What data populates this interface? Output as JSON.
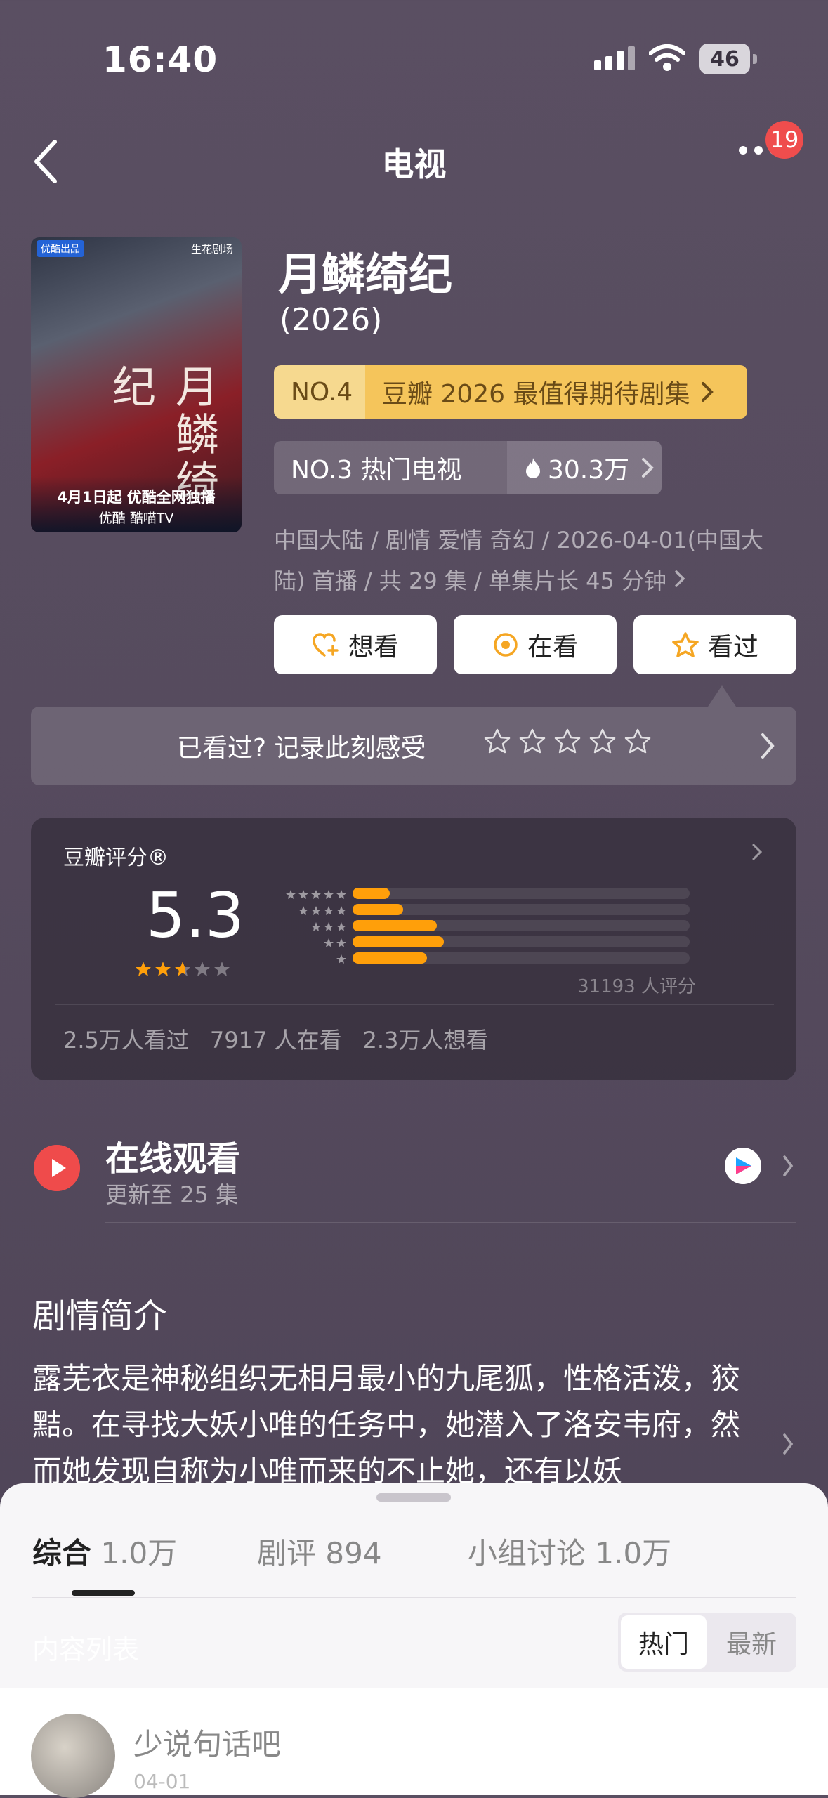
{
  "status": {
    "time": "16:40",
    "battery": "46"
  },
  "nav": {
    "title": "电视",
    "badge": "19"
  },
  "poster": {
    "tag_left": "优酷出品",
    "tag_right": "生花剧场",
    "title": "月鳞绮纪",
    "date": "4月1日起 优酷全网独播",
    "platform": "优酷  酷喵TV"
  },
  "show": {
    "title": "月鳞绮纪",
    "year": "(2026)",
    "rank": {
      "no": "NO.4",
      "text": "豆瓣 2026 最值得期待剧集"
    },
    "hot": {
      "no": "NO.3 热门电视",
      "heat": "30.3万"
    },
    "meta": "中国大陆 / 剧情 爱情 奇幻 / 2026-04-01(中国大陆) 首播 / 共 29 集 / 单集片长 45 分钟",
    "actions": {
      "want": "想看",
      "watching": "在看",
      "watched": "看过"
    },
    "record_prompt": "已看过? 记录此刻感受"
  },
  "rating": {
    "label": "豆瓣评分®",
    "score": "5.3",
    "star_fraction": 0.53,
    "distribution": [
      0.11,
      0.15,
      0.25,
      0.27,
      0.22
    ],
    "count": "31193 人评分",
    "stats": [
      "2.5万人看过",
      "7917 人在看",
      "2.3万人想看"
    ]
  },
  "online": {
    "title": "在线观看",
    "sub": "更新至 25 集"
  },
  "synopsis": {
    "heading": "剧情简介",
    "text": "露芜衣是神秘组织无相月最小的九尾狐，性格活泼，狡黠。在寻找大妖小唯的任务中，她潜入了洛安韦府，然而她发现自称为小唯而来的不止她，还有以妖"
  },
  "sheet": {
    "tabs": [
      {
        "label": "综合",
        "count": "1.0万"
      },
      {
        "label": "剧评",
        "count": "894"
      },
      {
        "label": "小组讨论",
        "count": "1.0万"
      }
    ],
    "list_label": "内容列表",
    "sort": {
      "hot": "热门",
      "new": "最新"
    },
    "comment_placeholder": "少说句话吧",
    "comment_date": "04-01"
  },
  "colors": {
    "accent_orange": "#ff9f0a",
    "rank_gold": "#f5c55b",
    "play_red": "#ef4b4b"
  }
}
